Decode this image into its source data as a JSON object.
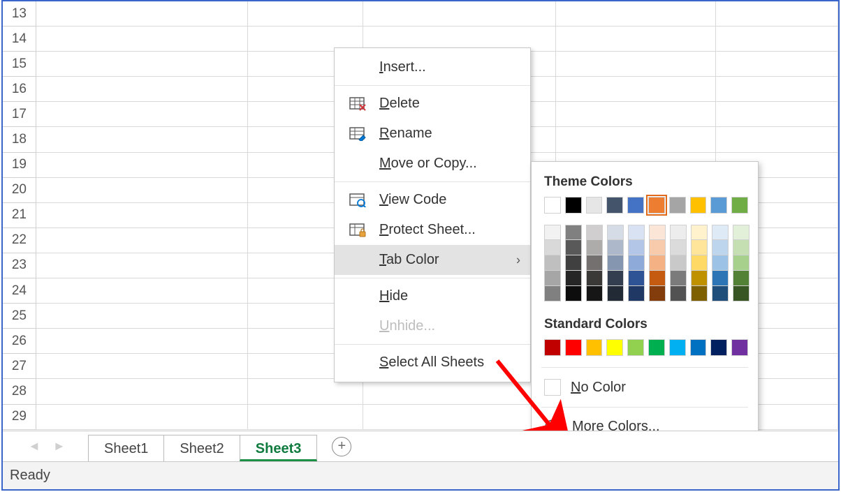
{
  "rows": {
    "start": 13,
    "end": 29
  },
  "columns": {
    "widths": [
      330,
      180,
      300,
      250,
      190
    ]
  },
  "tabs": {
    "items": [
      "Sheet1",
      "Sheet2",
      "Sheet3"
    ],
    "active_index": 2
  },
  "statusbar": {
    "text": "Ready"
  },
  "context_menu": {
    "items": [
      {
        "id": "insert",
        "label": "Insert...",
        "u": "I",
        "rest": "nsert...",
        "icon": null
      },
      {
        "id": "delete",
        "label": "Delete",
        "u": "D",
        "rest": "elete",
        "icon": "delete-table-icon"
      },
      {
        "id": "rename",
        "label": "Rename",
        "u": "R",
        "rest": "ename",
        "icon": "rename-icon"
      },
      {
        "id": "move",
        "label": "Move or Copy...",
        "u": "M",
        "rest": "ove or Copy...",
        "icon": null
      },
      {
        "id": "viewcode",
        "label": "View Code",
        "u": "V",
        "rest": "iew Code",
        "icon": "view-code-icon"
      },
      {
        "id": "protect",
        "label": "Protect Sheet...",
        "u": "P",
        "rest": "rotect Sheet...",
        "icon": "protect-icon"
      },
      {
        "id": "tabcolor",
        "label": "Tab Color",
        "u": "T",
        "rest": "ab Color",
        "submenu": true,
        "highlighted": true
      },
      {
        "id": "hide",
        "label": "Hide",
        "u": "H",
        "rest": "ide"
      },
      {
        "id": "unhide",
        "label": "Unhide...",
        "u": "U",
        "rest": "nhide...",
        "disabled": true
      },
      {
        "id": "selectall",
        "label": "Select All Sheets",
        "u": "S",
        "rest": "elect All Sheets"
      }
    ],
    "separators_after": [
      "insert",
      "move",
      "tabcolor",
      "unhide"
    ]
  },
  "color_popup": {
    "theme_title": "Theme Colors",
    "theme_row": [
      "#ffffff",
      "#000000",
      "#e7e6e6",
      "#44546a",
      "#4472c4",
      "#ed7d31",
      "#a5a5a5",
      "#ffc000",
      "#5b9bd5",
      "#70ad47"
    ],
    "theme_selected_index": 5,
    "theme_shades": [
      [
        "#f2f2f2",
        "#d9d9d9",
        "#bfbfbf",
        "#a6a6a6",
        "#808080"
      ],
      [
        "#808080",
        "#595959",
        "#404040",
        "#262626",
        "#0d0d0d"
      ],
      [
        "#d0cece",
        "#aeabab",
        "#757070",
        "#3b3838",
        "#171616"
      ],
      [
        "#d6dce5",
        "#adb9ca",
        "#8496b0",
        "#333f50",
        "#222a35"
      ],
      [
        "#d9e2f3",
        "#b4c6e7",
        "#8eaad8",
        "#2f5496",
        "#1f3864"
      ],
      [
        "#fbe5d6",
        "#f7cbac",
        "#f4b183",
        "#c55a11",
        "#833c0c"
      ],
      [
        "#ededed",
        "#dbdbdb",
        "#c9c9c9",
        "#7b7b7b",
        "#525252"
      ],
      [
        "#fff2cc",
        "#fee599",
        "#ffd966",
        "#bf9000",
        "#7f6000"
      ],
      [
        "#deebf6",
        "#bdd6ee",
        "#9cc3e6",
        "#2e75b5",
        "#1e4e79"
      ],
      [
        "#e2efd9",
        "#c5dfb3",
        "#a8d08d",
        "#538135",
        "#375623"
      ]
    ],
    "standard_title": "Standard Colors",
    "standard_row": [
      "#c00000",
      "#ff0000",
      "#ffc000",
      "#ffff00",
      "#92d050",
      "#00b050",
      "#00b0f0",
      "#0070c0",
      "#002060",
      "#7030a0"
    ],
    "no_color_label": "No Color",
    "no_color_u": "N",
    "no_color_rest": "o Color",
    "more_colors_label": "More Colors...",
    "more_colors_u": "M",
    "more_colors_rest": "ore Colors..."
  }
}
